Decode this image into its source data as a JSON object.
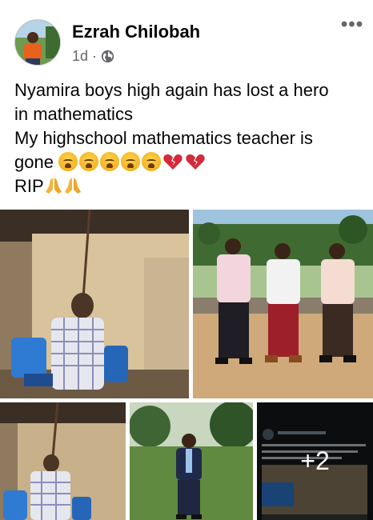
{
  "post": {
    "author": "Ezrah Chilobah",
    "time": "1d",
    "separator": "·",
    "privacy_icon": "globe-icon",
    "more_icon": "more-options-icon",
    "text": {
      "line1": "Nyamira boys high again has lost a hero",
      "line2": "in mathematics",
      "line3": "My highschool mathematics teacher is",
      "line4": "gone",
      "line5": "RIP"
    },
    "emojis": {
      "crying_faces": 5,
      "broken_hearts": 2,
      "praying_hands": 2
    }
  },
  "photos": {
    "count": 5,
    "more_label": "+2"
  },
  "colors": {
    "text": "#050505",
    "secondary": "#65676b"
  }
}
